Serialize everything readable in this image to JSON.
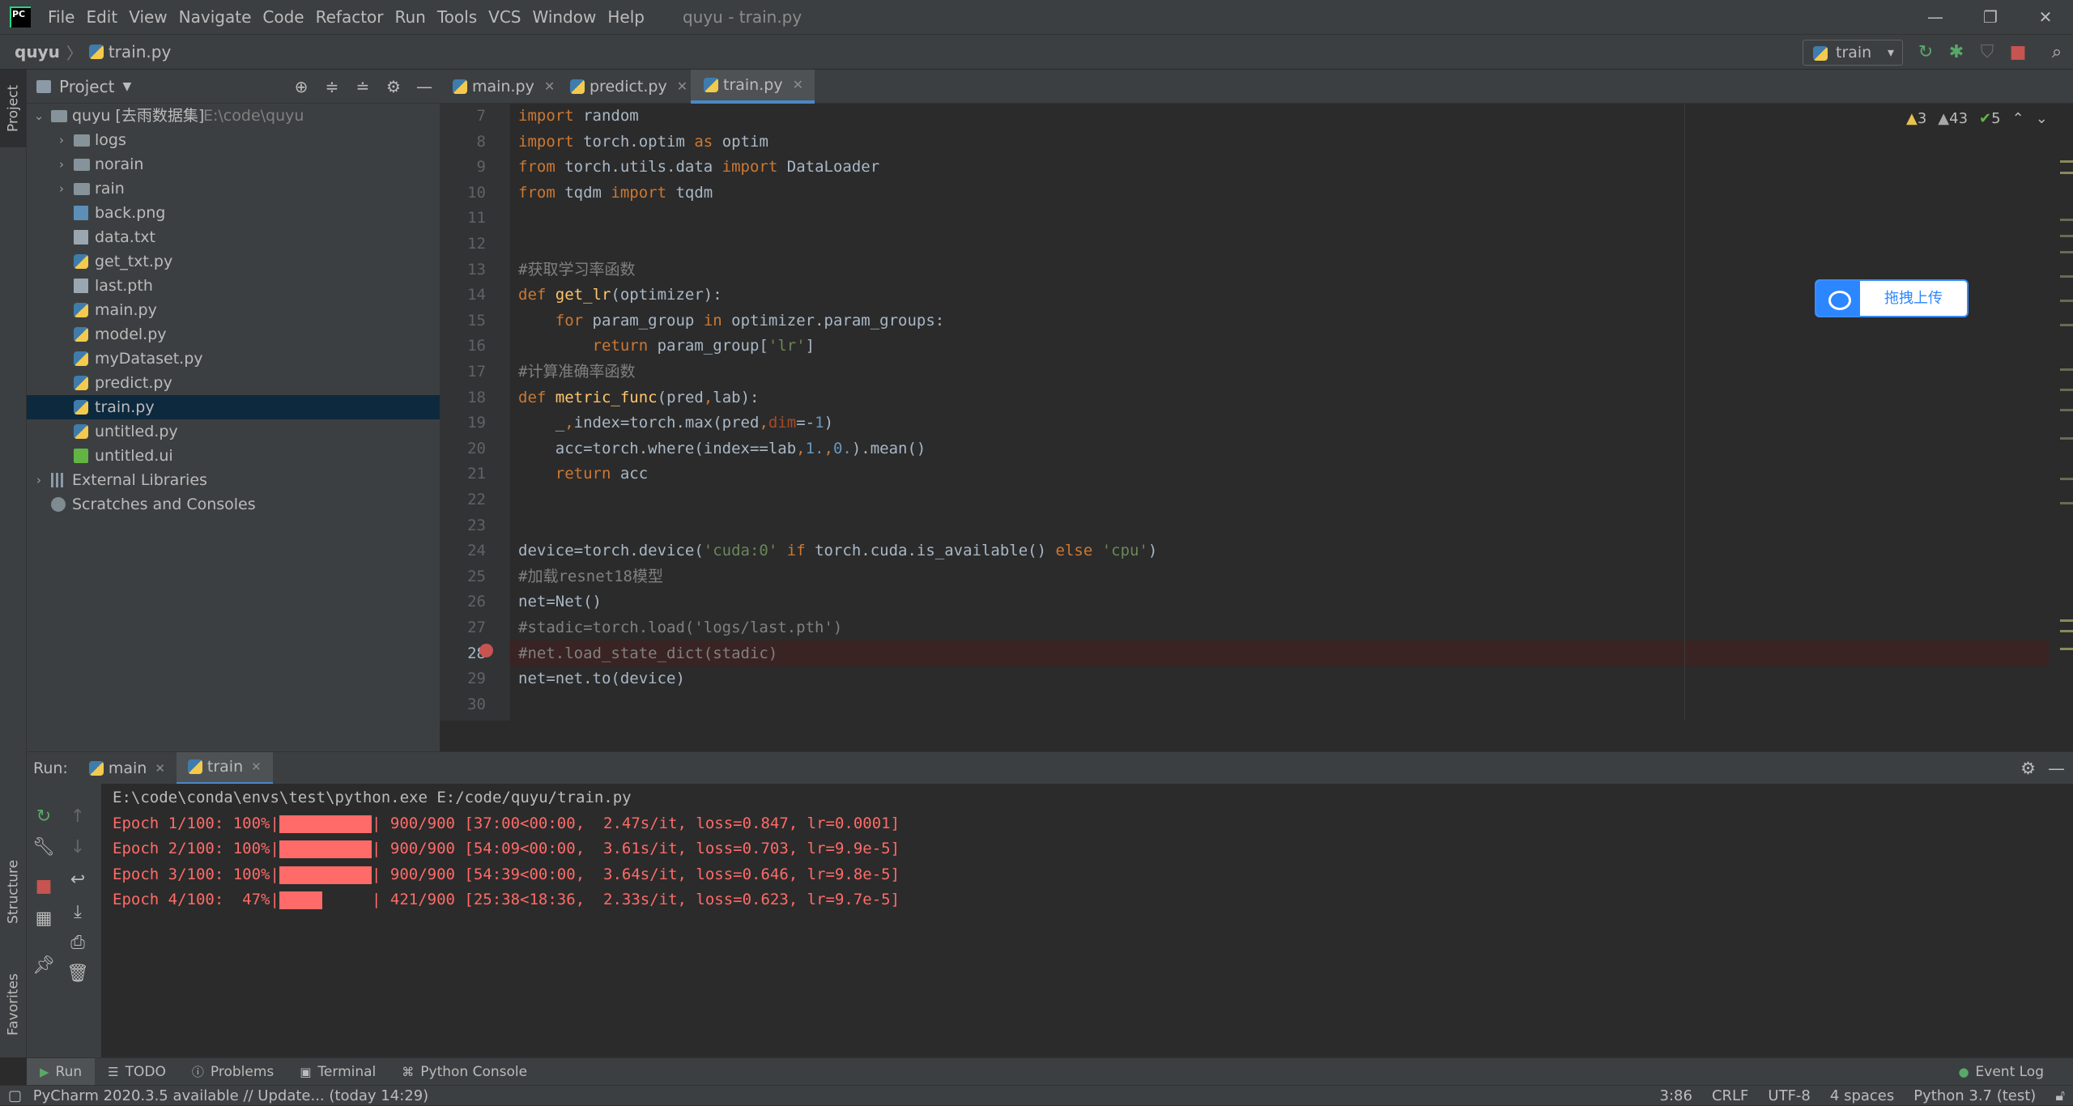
{
  "window": {
    "title": "quyu - train.py",
    "menu": [
      "File",
      "Edit",
      "View",
      "Navigate",
      "Code",
      "Refactor",
      "Run",
      "Tools",
      "VCS",
      "Window",
      "Help"
    ]
  },
  "nav": {
    "project": "quyu",
    "file": "train.py",
    "run_config": "train"
  },
  "project": {
    "title": "Project",
    "root_name": "quyu [去雨数据集]",
    "root_path": "E:\\code\\quyu",
    "folders": [
      "logs",
      "norain",
      "rain"
    ],
    "files": [
      "back.png",
      "data.txt",
      "get_txt.py",
      "last.pth",
      "main.py",
      "model.py",
      "myDataset.py",
      "predict.py",
      "train.py",
      "untitled.py",
      "untitled.ui"
    ],
    "external": "External Libraries",
    "scratches": "Scratches and Consoles"
  },
  "side_tabs": {
    "project": "Project",
    "structure": "Structure",
    "favorites": "Favorites"
  },
  "editor": {
    "tabs": [
      "main.py",
      "predict.py",
      "train.py"
    ],
    "active_tab": "train.py",
    "line_numbers": [
      "7",
      "8",
      "9",
      "10",
      "11",
      "12",
      "13",
      "14",
      "15",
      "16",
      "17",
      "18",
      "19",
      "20",
      "21",
      "22",
      "23",
      "24",
      "25",
      "26",
      "27",
      "28",
      "29",
      "30"
    ],
    "inspections": {
      "warnings": "3",
      "weak_warnings": "43",
      "typos": "5"
    },
    "breakpoint_line": "28"
  },
  "overlay": {
    "label": "拖拽上传"
  },
  "run": {
    "label": "Run:",
    "tabs": [
      "main",
      "train"
    ],
    "active_tab": "train",
    "cmd": "E:\\code\\conda\\envs\\test\\python.exe E:/code/quyu/train.py",
    "epochs": [
      {
        "prefix": "Epoch 1/100: 100%|",
        "suffix": "| 900/900 [37:00<00:00,  2.47s/it, loss=0.847, lr=0.0001]",
        "progress": 1.0
      },
      {
        "prefix": "Epoch 2/100: 100%|",
        "suffix": "| 900/900 [54:09<00:00,  3.61s/it, loss=0.703, lr=9.9e-5]",
        "progress": 1.0
      },
      {
        "prefix": "Epoch 3/100: 100%|",
        "suffix": "| 900/900 [54:39<00:00,  3.64s/it, loss=0.646, lr=9.8e-5]",
        "progress": 1.0
      },
      {
        "prefix": "Epoch 4/100:  47%|",
        "suffix": "| 421/900 [25:38<18:36,  2.33s/it, loss=0.623, lr=9.7e-5]",
        "progress": 0.47
      }
    ]
  },
  "bottom_tabs": [
    "Run",
    "TODO",
    "Problems",
    "Terminal",
    "Python Console"
  ],
  "event_log": "Event Log",
  "status": {
    "message": "PyCharm 2020.3.5 available // Update... (today 14:29)",
    "position": "3:86",
    "line_sep": "CRLF",
    "encoding": "UTF-8",
    "indent": "4 spaces",
    "interpreter": "Python 3.7 (test)"
  },
  "colors": {
    "accent": "#4a88c7",
    "error": "#ff6b68",
    "keyword": "#cc7832",
    "string": "#6a8759",
    "comment": "#808080"
  }
}
